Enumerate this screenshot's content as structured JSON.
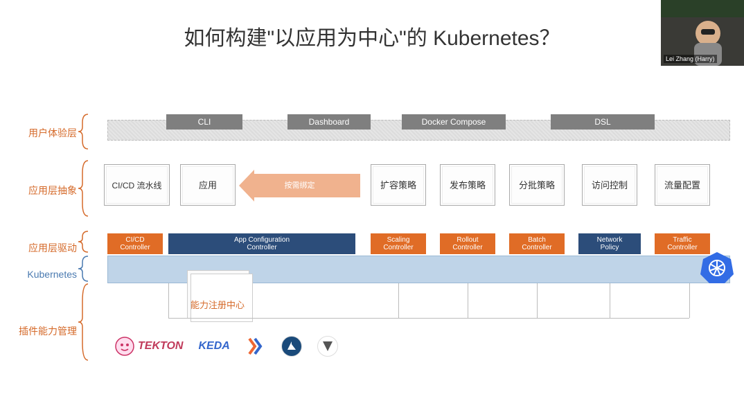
{
  "title": "如何构建\"以应用为中心\"的 Kubernetes？",
  "presenter": {
    "name": "Lei Zhang (Harry)"
  },
  "layers": {
    "ux": "用户体验层",
    "abs": "应用层抽象",
    "drive": "应用层驱动",
    "kube": "Kubernetes",
    "plugin": "插件能力管理"
  },
  "ux_tabs": [
    "CLI",
    "Dashboard",
    "Docker Compose",
    "DSL"
  ],
  "abs_docs": {
    "pipeline": "CI/CD 流水线",
    "app": "应用",
    "scale": "扩容策略",
    "release": "发布策略",
    "batch": "分批策略",
    "access": "访问控制",
    "traffic": "流量配置"
  },
  "arrow_label": "按需绑定",
  "controllers": {
    "cicd": "CI/CD\nController",
    "appcfg": "App Configuration\nController",
    "scaling": "Scaling\nController",
    "rollout": "Rollout\nController",
    "batch": "Batch\nController",
    "netpol": "Network\nPolicy",
    "traffic": "Traffic\nController"
  },
  "registry_label": "能力注册中心",
  "logos": {
    "tekton": "TEKTON",
    "keda": "KEDA"
  }
}
